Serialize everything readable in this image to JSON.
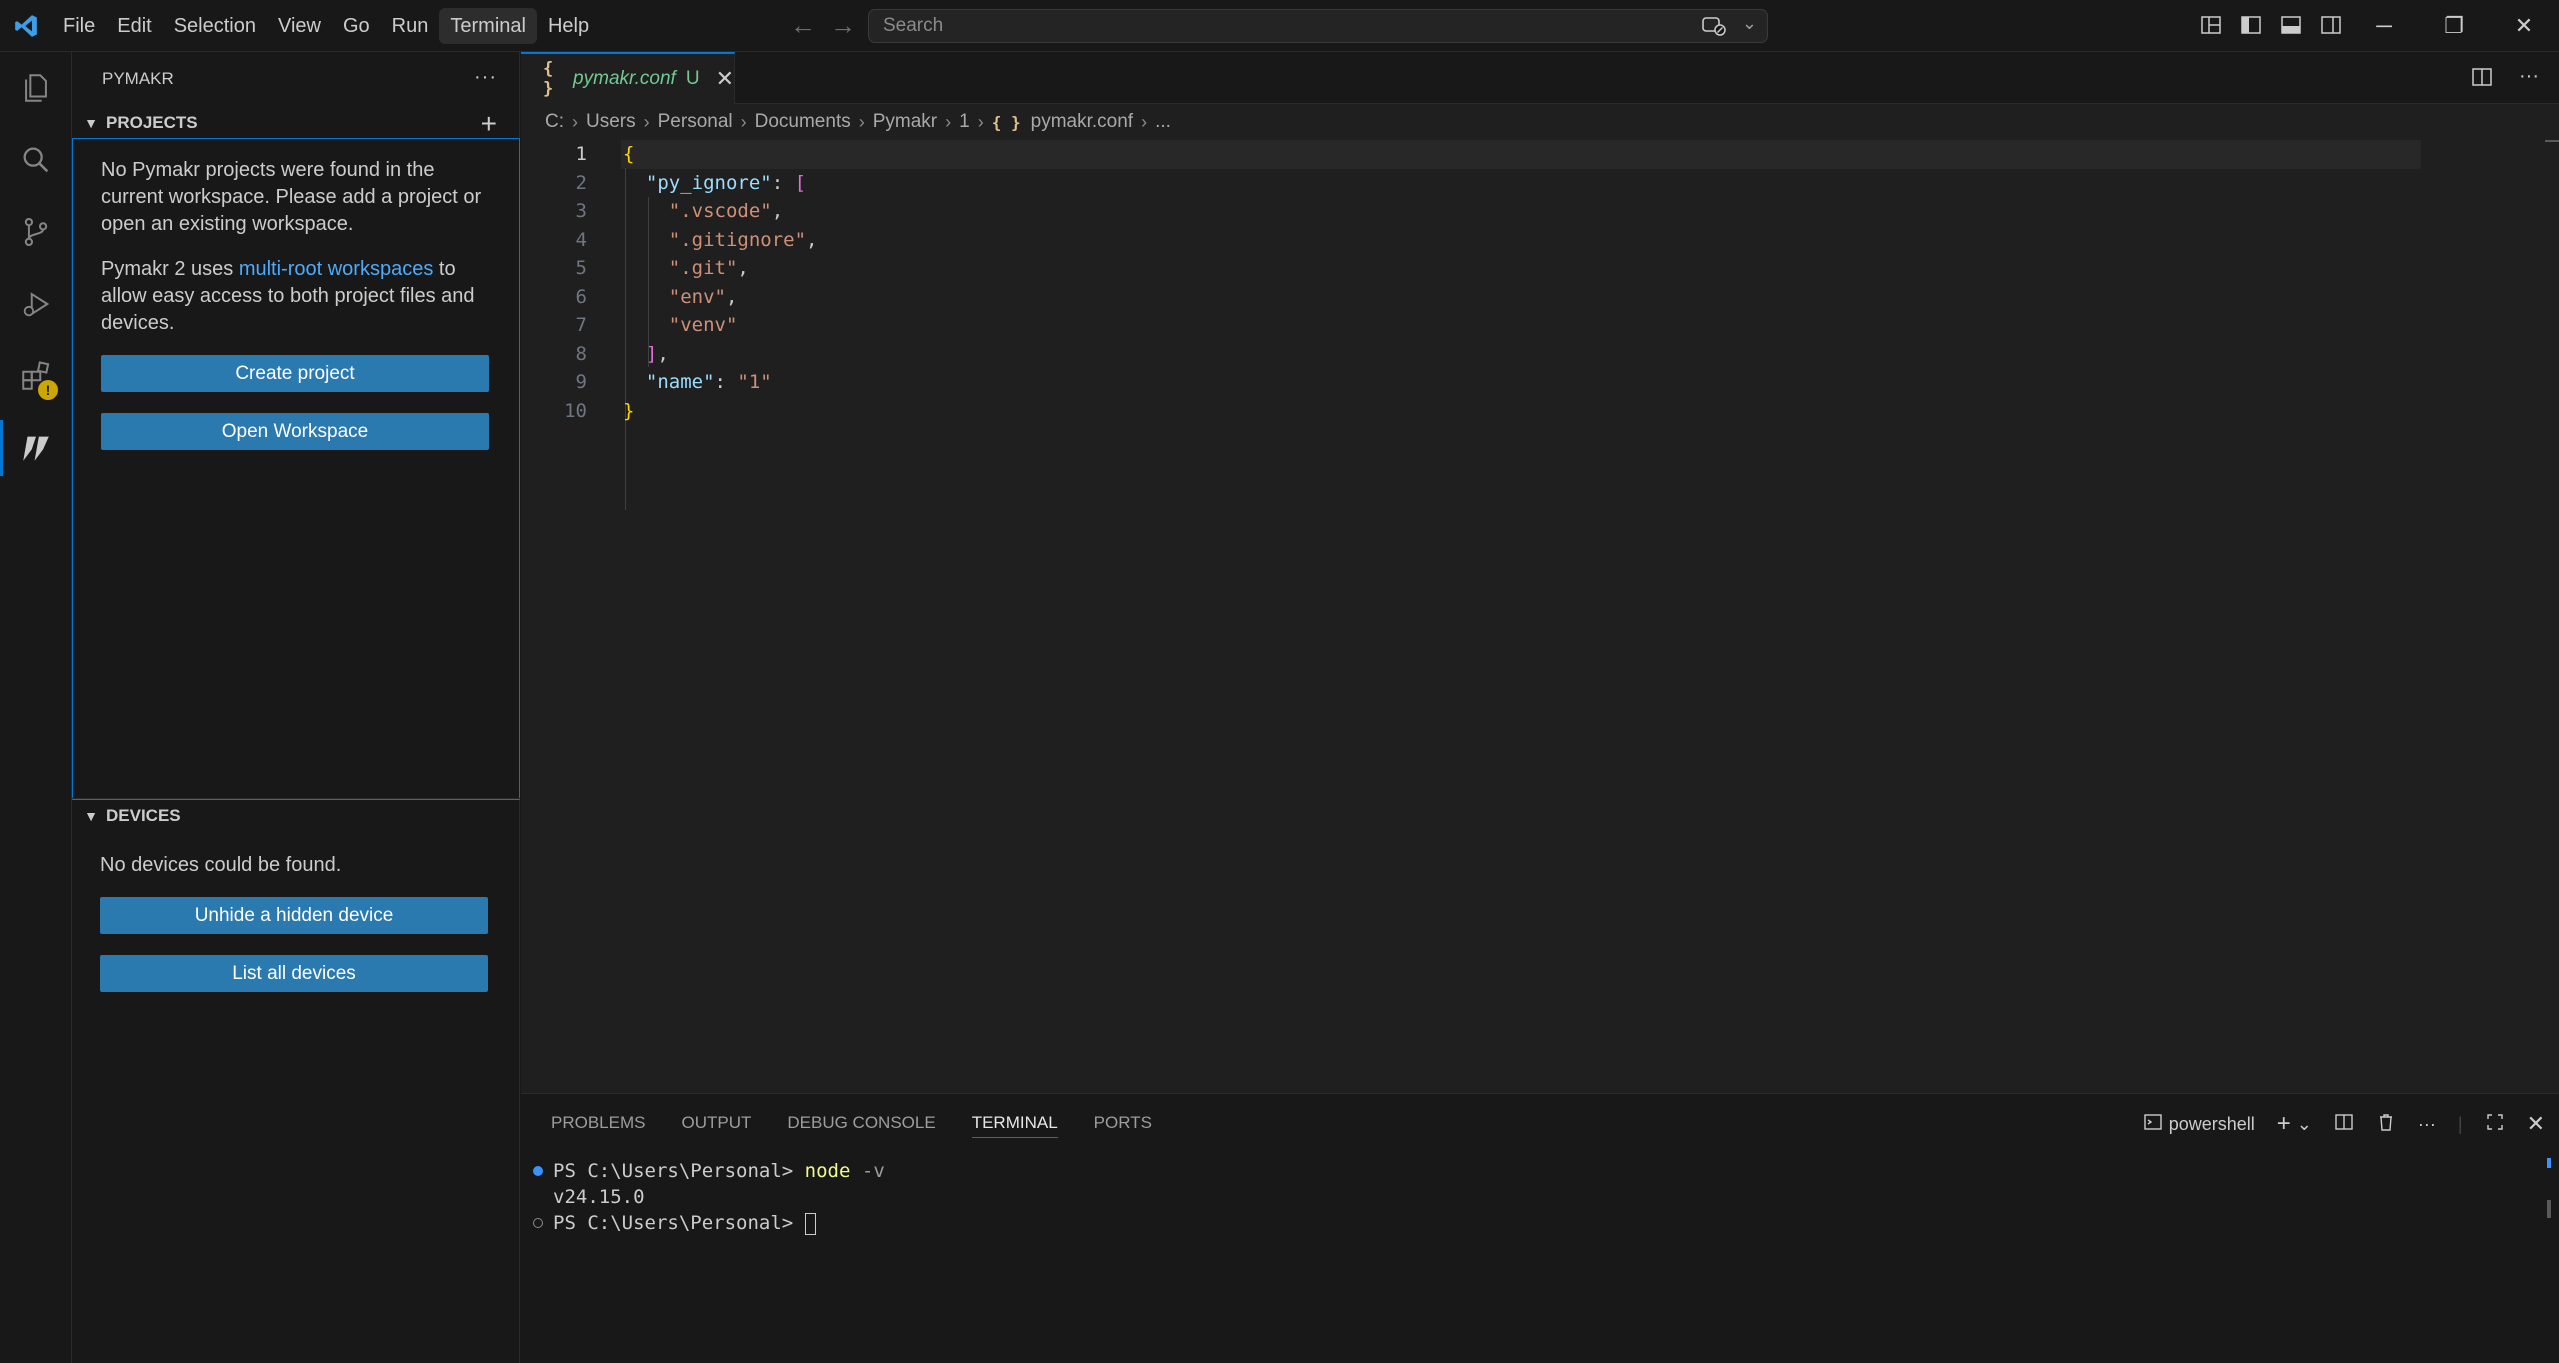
{
  "menu": [
    "File",
    "Edit",
    "Selection",
    "View",
    "Go",
    "Run",
    "Terminal",
    "Help"
  ],
  "menu_active": "Terminal",
  "search": {
    "placeholder": "Search"
  },
  "sidebar": {
    "title": "PYMAKR",
    "projects": {
      "header": "PROJECTS",
      "message": "No Pymakr projects were found in the current workspace. Please add a project or open an existing workspace.",
      "info_prefix": "Pymakr 2 uses ",
      "info_link": "multi-root workspaces",
      "info_suffix": " to allow easy access to both project files and devices.",
      "create_button": "Create project",
      "open_button": "Open Workspace"
    },
    "devices": {
      "header": "DEVICES",
      "message": "No devices could be found.",
      "unhide_button": "Unhide a hidden device",
      "list_button": "List all devices"
    }
  },
  "tab": {
    "icon": "{ }",
    "name": "pymakr.conf",
    "status": "U"
  },
  "breadcrumb": {
    "parts": [
      "C:",
      "Users",
      "Personal",
      "Documents",
      "Pymakr",
      "1"
    ],
    "file_icon": "{ }",
    "file": "pymakr.conf",
    "tail": "..."
  },
  "editor": {
    "line_numbers": [
      "1",
      "2",
      "3",
      "4",
      "5",
      "6",
      "7",
      "8",
      "9",
      "10"
    ],
    "code": {
      "l1": "{",
      "l2_key": "\"py_ignore\"",
      "l2_sep": ": ",
      "l2_open": "[",
      "l3": "\".vscode\"",
      "l4": "\".gitignore\"",
      "l5": "\".git\"",
      "l6": "\"env\"",
      "l7": "\"venv\"",
      "l8": "]",
      "l9_key": "\"name\"",
      "l9_val": "\"1\"",
      "l10": "}"
    }
  },
  "panel": {
    "tabs": [
      "PROBLEMS",
      "OUTPUT",
      "DEBUG CONSOLE",
      "TERMINAL",
      "PORTS"
    ],
    "active_tab": "TERMINAL",
    "shell": "powershell",
    "terminal": {
      "prompt1": "PS C:\\Users\\Personal> ",
      "cmd1": "node",
      "flag1": " -v",
      "output1": "v24.15.0",
      "prompt2": "PS C:\\Users\\Personal> "
    }
  },
  "colors": {
    "accent": "#0078d4",
    "button": "#2a7ab0",
    "link": "#4daafc",
    "untracked": "#73c991",
    "warning": "#cca700"
  }
}
